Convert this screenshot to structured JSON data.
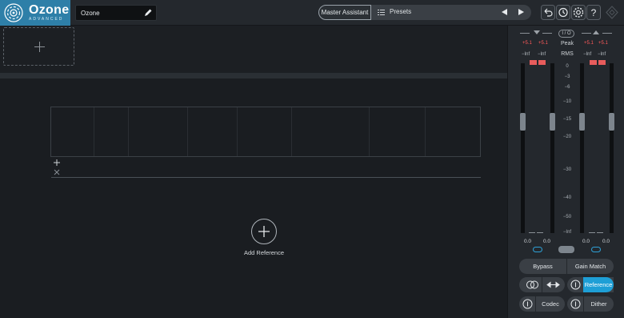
{
  "app": {
    "title": "Ozone",
    "subtitle": "ADVANCED"
  },
  "header": {
    "preset_name": "Ozone",
    "master_assistant_label": "Master Assistant",
    "presets_label": "Presets"
  },
  "reference": {
    "add_label": "Add Reference"
  },
  "meters": {
    "io_label": "I / O",
    "mode_peak": "Peak",
    "mode_rms": "RMS",
    "peak_values": [
      "+5.1",
      "+5.1",
      "+5.1",
      "+5.1"
    ],
    "rms_values": [
      "−Inf",
      "−Inf",
      "−Inf",
      "−Inf"
    ],
    "scale": [
      "0",
      "−3",
      "−6",
      "−10",
      "−15",
      "−20",
      "−30",
      "−40",
      "−50",
      "−Inf"
    ],
    "gain_values": [
      "0.0",
      "0.0",
      "0.0",
      "0.0"
    ]
  },
  "controls": {
    "bypass": "Bypass",
    "gain_match": "Gain Match",
    "reference": "Reference",
    "codec": "Codec",
    "dither": "Dither"
  },
  "colors": {
    "accent": "#1e9fd6",
    "brand": "#2e7fa8",
    "clip": "#e85c5c",
    "peak_text": "#ff5a5a"
  },
  "icons": [
    "ozone-logo-icon",
    "pencil-icon",
    "list-icon",
    "prev-arrow-icon",
    "next-arrow-icon",
    "undo-icon",
    "history-icon",
    "settings-gear-icon",
    "help-icon",
    "ireact-logo-icon",
    "plus-icon",
    "close-icon",
    "power-icon",
    "stereo-icon",
    "swap-arrows-icon"
  ]
}
